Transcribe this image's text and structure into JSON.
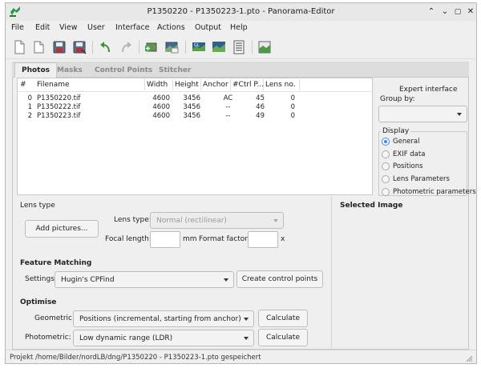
{
  "window": {
    "title": "P1350220 - P1350223-1.pto - Panorama-Editor",
    "controls": {
      "minimize": "⌃",
      "restore": "⌄",
      "maximize": "▢",
      "close": "✕"
    }
  },
  "menu": [
    "File",
    "Edit",
    "View",
    "User",
    "Interface",
    "Actions",
    "Output",
    "Help"
  ],
  "toolbar": {
    "icons": [
      "new-project-icon",
      "open-project-icon",
      "save-icon",
      "save-as-icon",
      "undo-icon",
      "redo-icon",
      "add-images-icon",
      "remove-images-icon",
      "fast-preview-icon",
      "gl-preview-icon",
      "layout-icon",
      "stitch-icon"
    ]
  },
  "tabs": [
    {
      "label": "Photos",
      "active": true
    },
    {
      "label": "Masks",
      "active": false
    },
    {
      "label": "Control Points",
      "active": false
    },
    {
      "label": "Stitcher",
      "active": false
    }
  ],
  "table": {
    "headers": [
      "#",
      "Filename",
      "Width",
      "Height",
      "Anchor",
      "#Ctrl P...",
      "Lens no."
    ],
    "rows": [
      [
        "0",
        "P1350220.tif",
        "4600",
        "3456",
        "AC",
        "45",
        "0"
      ],
      [
        "1",
        "P1350222.tif",
        "4600",
        "3456",
        "--",
        "46",
        "0"
      ],
      [
        "2",
        "P1350223.tif",
        "4600",
        "3456",
        "--",
        "49",
        "0"
      ]
    ]
  },
  "side": {
    "expert_label": "Expert interface",
    "group_by_label": "Group by:",
    "group_by_value": "",
    "display_label": "Display",
    "display_options": [
      {
        "label": "General",
        "checked": true
      },
      {
        "label": "EXIF data",
        "checked": false
      },
      {
        "label": "Positions",
        "checked": false
      },
      {
        "label": "Lens Parameters",
        "checked": false
      },
      {
        "label": "Photometric parameters",
        "checked": false
      }
    ]
  },
  "lens": {
    "section_title": "Lens type",
    "add_pictures": "Add pictures...",
    "lens_type_label": "Lens type:",
    "lens_type_value": "Normal (rectilinear)",
    "focal_length_label": "Focal length:",
    "focal_length_value": "",
    "focal_unit": "mm",
    "format_factor_label": "Format factor:",
    "format_factor_value": "",
    "format_factor_unit": "x"
  },
  "selected_image": {
    "title": "Selected Image"
  },
  "feature_matching": {
    "section_title": "Feature Matching",
    "settings_label": "Settings:",
    "settings_value": "Hugin's CPFind",
    "create_button": "Create control points"
  },
  "optimise": {
    "section_title": "Optimise",
    "geometric_label": "Geometric:",
    "geometric_value": "Positions (incremental, starting from anchor)",
    "photometric_label": "Photometric:",
    "photometric_value": "Low dynamic range (LDR)",
    "calculate": "Calculate"
  },
  "status": {
    "text": "Projekt /home/Bilder/nordLB/dng/P1350220 - P1350223-1.pto gespeichert"
  },
  "colors": {
    "accent": "#3a87d9",
    "window_bg": "#efefef",
    "app_icon": "#2a9a4a"
  }
}
